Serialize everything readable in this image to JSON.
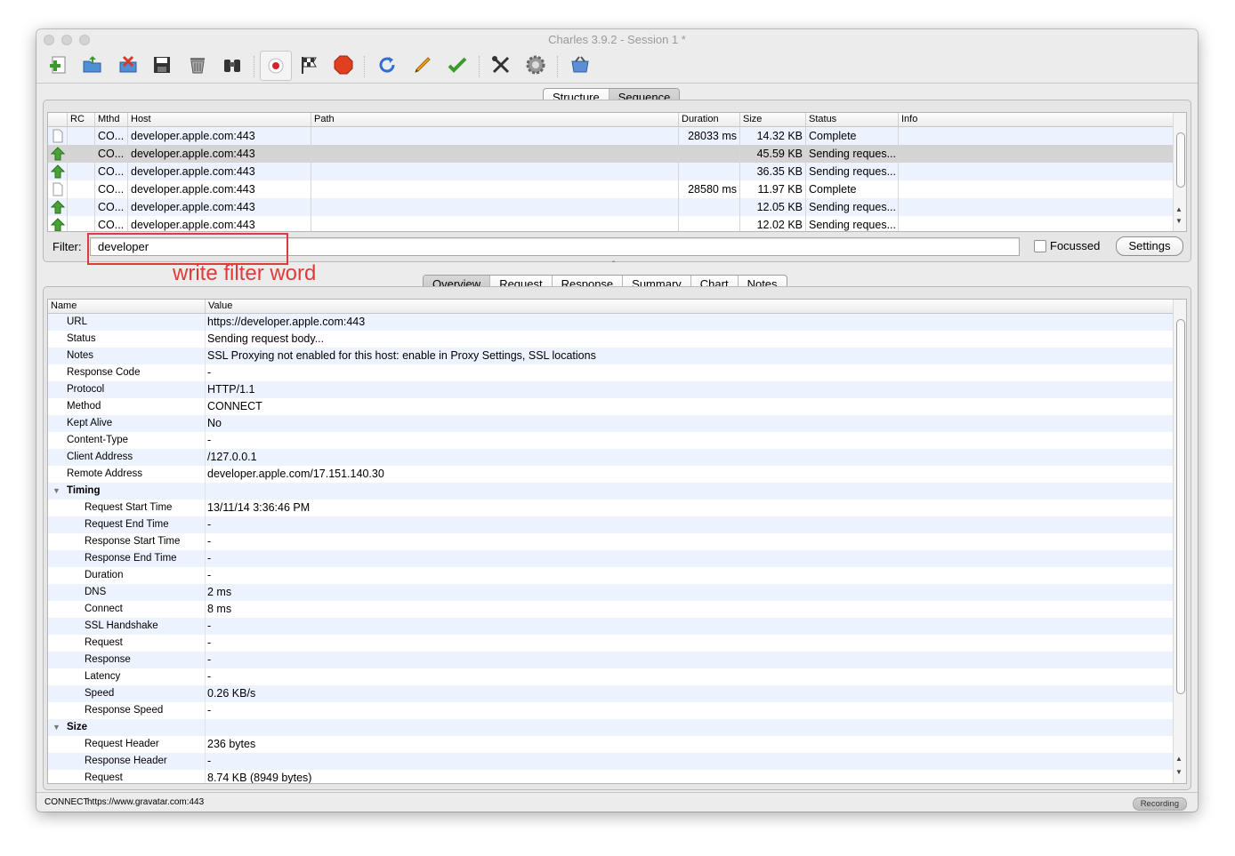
{
  "window": {
    "title": "Charles 3.9.2 - Session 1 *"
  },
  "toolbar": {
    "buttons": [
      {
        "icon": "new-session-icon"
      },
      {
        "icon": "open-session-icon"
      },
      {
        "icon": "close-session-icon"
      },
      {
        "icon": "save-icon"
      },
      {
        "icon": "trash-icon"
      },
      {
        "icon": "binoculars-icon"
      },
      {
        "icon": "record-icon"
      },
      {
        "icon": "throttle-flag-icon"
      },
      {
        "icon": "stop-icon"
      },
      {
        "icon": "refresh-icon"
      },
      {
        "icon": "edit-pencil-icon"
      },
      {
        "icon": "validate-check-icon"
      },
      {
        "icon": "tools-icon"
      },
      {
        "icon": "settings-gear-icon"
      },
      {
        "icon": "shopping-basket-icon"
      }
    ]
  },
  "view_tabs": {
    "structure": "Structure",
    "sequence": "Sequence"
  },
  "sequence": {
    "columns": {
      "rc": "RC",
      "method": "Mthd",
      "host": "Host",
      "path": "Path",
      "duration": "Duration",
      "size": "Size",
      "status": "Status",
      "info": "Info"
    },
    "rows": [
      {
        "icon": "document-icon",
        "method": "CO...",
        "host": "developer.apple.com:443",
        "path": "",
        "duration": "28033 ms",
        "size": "14.32 KB",
        "status": "Complete",
        "info": ""
      },
      {
        "icon": "upload-arrow-icon",
        "method": "CO...",
        "host": "developer.apple.com:443",
        "path": "",
        "duration": "",
        "size": "45.59 KB",
        "status": "Sending reques...",
        "info": ""
      },
      {
        "icon": "upload-arrow-icon",
        "method": "CO...",
        "host": "developer.apple.com:443",
        "path": "",
        "duration": "",
        "size": "36.35 KB",
        "status": "Sending reques...",
        "info": ""
      },
      {
        "icon": "document-icon",
        "method": "CO...",
        "host": "developer.apple.com:443",
        "path": "",
        "duration": "28580 ms",
        "size": "11.97 KB",
        "status": "Complete",
        "info": ""
      },
      {
        "icon": "upload-arrow-icon",
        "method": "CO...",
        "host": "developer.apple.com:443",
        "path": "",
        "duration": "",
        "size": "12.05 KB",
        "status": "Sending reques...",
        "info": ""
      },
      {
        "icon": "upload-arrow-icon",
        "method": "CO...",
        "host": "developer.apple.com:443",
        "path": "",
        "duration": "",
        "size": "12.02 KB",
        "status": "Sending reques...",
        "info": ""
      }
    ],
    "selected_row": 1
  },
  "filter": {
    "label": "Filter:",
    "value": "developer",
    "focussed_label": "Focussed",
    "focussed_checked": false,
    "settings_label": "Settings"
  },
  "annotation": {
    "text": "write filter word",
    "color": "#e03b3b"
  },
  "detail_tabs": {
    "overview": "Overview",
    "request": "Request",
    "response": "Response",
    "summary": "Summary",
    "chart": "Chart",
    "notes": "Notes"
  },
  "overview": {
    "columns": {
      "name": "Name",
      "value": "Value"
    },
    "rows": [
      {
        "name": "URL",
        "value": "https://developer.apple.com:443"
      },
      {
        "name": "Status",
        "value": "Sending request body..."
      },
      {
        "name": "Notes",
        "value": "SSL Proxying not enabled for this host: enable in Proxy Settings, SSL locations"
      },
      {
        "name": "Response Code",
        "value": "-"
      },
      {
        "name": "Protocol",
        "value": "HTTP/1.1"
      },
      {
        "name": "Method",
        "value": "CONNECT"
      },
      {
        "name": "Kept Alive",
        "value": "No"
      },
      {
        "name": "Content-Type",
        "value": "-"
      },
      {
        "name": "Client Address",
        "value": "/127.0.0.1"
      },
      {
        "name": "Remote Address",
        "value": "developer.apple.com/17.151.140.30"
      },
      {
        "name": "Timing",
        "value": "",
        "section": true
      },
      {
        "name": "Request Start Time",
        "value": "13/11/14 3:36:46 PM",
        "indent": true
      },
      {
        "name": "Request End Time",
        "value": "-",
        "indent": true
      },
      {
        "name": "Response Start Time",
        "value": "-",
        "indent": true
      },
      {
        "name": "Response End Time",
        "value": "-",
        "indent": true
      },
      {
        "name": "Duration",
        "value": "-",
        "indent": true
      },
      {
        "name": "DNS",
        "value": "2 ms",
        "indent": true
      },
      {
        "name": "Connect",
        "value": "8 ms",
        "indent": true
      },
      {
        "name": "SSL Handshake",
        "value": "-",
        "indent": true
      },
      {
        "name": "Request",
        "value": "-",
        "indent": true
      },
      {
        "name": "Response",
        "value": "-",
        "indent": true
      },
      {
        "name": "Latency",
        "value": "-",
        "indent": true
      },
      {
        "name": "Speed",
        "value": "0.26 KB/s",
        "indent": true
      },
      {
        "name": "Response Speed",
        "value": "-",
        "indent": true
      },
      {
        "name": "Size",
        "value": "",
        "section": true
      },
      {
        "name": "Request Header",
        "value": "236 bytes",
        "indent": true
      },
      {
        "name": "Response Header",
        "value": "-",
        "indent": true
      },
      {
        "name": "Request",
        "value": "8.74 KB (8949 bytes)",
        "indent": true
      }
    ]
  },
  "statusbar": {
    "method": "CONNECT",
    "url": "https://www.gravatar.com:443",
    "recording": "Recording"
  },
  "colors": {
    "row_alt": "#edf3fe",
    "row_selected": "#d4d4d4",
    "accent_red": "#e03b3b"
  }
}
